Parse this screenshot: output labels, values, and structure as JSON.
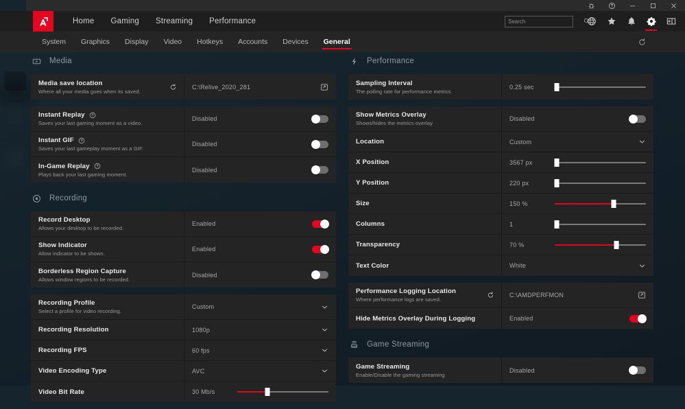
{
  "window": {
    "titlebar_icons": [
      "bug-icon",
      "help-icon",
      "minimize-icon",
      "maximize-icon",
      "close-icon"
    ]
  },
  "nav": {
    "logo_alt": "amd-radeon-logo",
    "items": [
      {
        "label": "Home",
        "active": false
      },
      {
        "label": "Gaming",
        "active": false
      },
      {
        "label": "Streaming",
        "active": false
      },
      {
        "label": "Performance",
        "active": false
      }
    ],
    "search": {
      "value": "",
      "placeholder": "Search"
    },
    "icons": [
      {
        "name": "globe-icon",
        "active": false
      },
      {
        "name": "star-icon",
        "active": false
      },
      {
        "name": "bell-icon",
        "active": false
      },
      {
        "name": "gear-icon",
        "active": true
      },
      {
        "name": "panel-icon",
        "active": false
      }
    ]
  },
  "tabs": {
    "items": [
      {
        "label": "System",
        "active": false
      },
      {
        "label": "Graphics",
        "active": false
      },
      {
        "label": "Display",
        "active": false
      },
      {
        "label": "Video",
        "active": false
      },
      {
        "label": "Hotkeys",
        "active": false
      },
      {
        "label": "Accounts",
        "active": false
      },
      {
        "label": "Devices",
        "active": false
      },
      {
        "label": "General",
        "active": true
      }
    ],
    "refresh_icon": "reset-icon"
  },
  "colors": {
    "accent_red": "#e40521",
    "row_bg": "#242424",
    "panel_bg": "#1e1e1e",
    "desktop_bg": "#16242e",
    "muted_text": "#9a9a9a"
  },
  "sections": {
    "media": {
      "title": "Media",
      "icon": "media-play-icon",
      "rows": {
        "media_save_location": {
          "title": "Media save location",
          "sub": "Where all your media goes when its saved.",
          "value": "C:\\Relive_2020_281"
        },
        "instant_replay": {
          "title": "Instant Replay",
          "sub": "Saves your last gaming moment as a video.",
          "value": "Disabled",
          "state": "off"
        },
        "instant_gif": {
          "title": "Instant GIF",
          "sub": "Saves your last gameplay moment as a GIF.",
          "value": "Disabled",
          "state": "off"
        },
        "in_game_replay": {
          "title": "In-Game Replay",
          "sub": "Plays back your last gaming moment.",
          "value": "Disabled",
          "state": "off"
        }
      }
    },
    "recording": {
      "title": "Recording",
      "icon": "record-icon",
      "rows": {
        "record_desktop": {
          "title": "Record Desktop",
          "sub": "Allows your desktop to be recorded.",
          "value": "Enabled",
          "state": "on"
        },
        "show_indicator": {
          "title": "Show Indicator",
          "sub": "Allow indicator to be shown.",
          "value": "Enabled",
          "state": "on"
        },
        "borderless_region_capture": {
          "title": "Borderless Region Capture",
          "sub": "Allows window regions to be recorded.",
          "value": "Disabled",
          "state": "off"
        },
        "recording_profile": {
          "title": "Recording Profile",
          "sub": "Select a profile for video recording.",
          "value": "Custom"
        },
        "recording_resolution": {
          "title": "Recording Resolution",
          "value": "1080p"
        },
        "recording_fps": {
          "title": "Recording FPS",
          "value": "60 fps"
        },
        "video_encoding_type": {
          "title": "Video Encoding Type",
          "value": "AVC"
        },
        "video_bit_rate": {
          "title": "Video Bit Rate",
          "value": "30 Mb/s",
          "percent": 33
        }
      }
    },
    "performance": {
      "title": "Performance",
      "icon": "lightning-icon",
      "rows": {
        "sampling_interval": {
          "title": "Sampling Interval",
          "sub": "The polling rate for performance metrics",
          "value": "0.25 sec",
          "percent": 2
        },
        "show_metrics_overlay": {
          "title": "Show Metrics Overlay",
          "sub": "Shows/hides the metrics overlay",
          "value": "Disabled",
          "state": "off"
        },
        "location": {
          "title": "Location",
          "value": "Custom"
        },
        "x_position": {
          "title": "X Position",
          "value": "3567 px",
          "percent": 2
        },
        "y_position": {
          "title": "Y Position",
          "value": "220 px",
          "percent": 2
        },
        "size": {
          "title": "Size",
          "value": "150 %",
          "percent": 65
        },
        "columns": {
          "title": "Columns",
          "value": "1",
          "percent": 2
        },
        "transparency": {
          "title": "Transparency",
          "value": "70 %",
          "percent": 68
        },
        "text_color": {
          "title": "Text Color",
          "value": "White"
        },
        "performance_logging_location": {
          "title": "Performance Logging Location",
          "sub": "Where performance logs are saved.",
          "value": "C:\\AMDPERFMON"
        },
        "hide_metrics_overlay_during_logging": {
          "title": "Hide Metrics Overlay During Logging",
          "value": "Enabled",
          "state": "on"
        }
      }
    },
    "game_streaming": {
      "title": "Game Streaming",
      "icon": "broadcast-icon",
      "rows": {
        "game_streaming": {
          "title": "Game Streaming",
          "sub": "Enable/Disable the gaming streaming",
          "value": "Disabled",
          "state": "off"
        }
      }
    }
  }
}
